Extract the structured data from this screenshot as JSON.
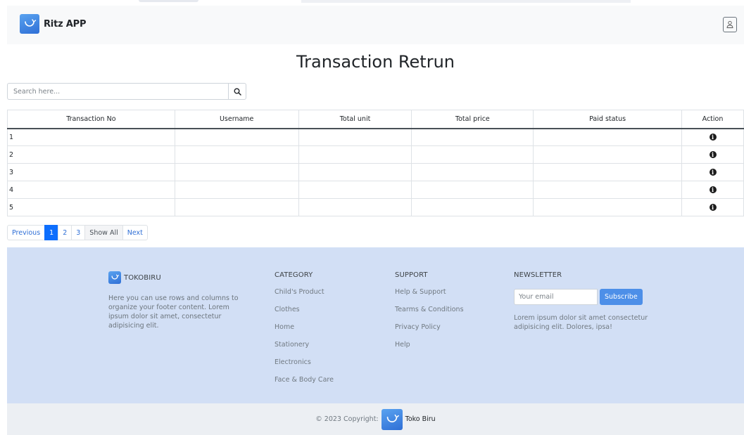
{
  "app": {
    "name": "Ritz APP"
  },
  "page": {
    "title": "Transaction Retrun"
  },
  "search": {
    "placeholder": "Search here..."
  },
  "table": {
    "headers": [
      "Transaction No",
      "Username",
      "Total unit",
      "Total price",
      "Paid status",
      "Action"
    ],
    "rows": [
      {
        "no": "1",
        "username": "",
        "unit": "",
        "price": "",
        "status": "",
        "action": "i"
      },
      {
        "no": "2",
        "username": "",
        "unit": "",
        "price": "",
        "status": "",
        "action": "i"
      },
      {
        "no": "3",
        "username": "",
        "unit": "",
        "price": "",
        "status": "",
        "action": "i"
      },
      {
        "no": "4",
        "username": "",
        "unit": "",
        "price": "",
        "status": "",
        "action": "i"
      },
      {
        "no": "5",
        "username": "",
        "unit": "",
        "price": "",
        "status": "",
        "action": "i"
      }
    ]
  },
  "pagination": {
    "previous": "Previous",
    "pages": [
      "1",
      "2",
      "3"
    ],
    "active_page": "1",
    "show_all": "Show All",
    "next": "Next"
  },
  "footer": {
    "brand": "TOKOBIRU",
    "about": "Here you can use rows and columns to organize your footer content. Lorem ipsum dolor sit amet, consectetur adipisicing elit.",
    "category": {
      "heading": "CATEGORY",
      "items": [
        "Child's Product",
        "Clothes",
        "Home",
        "Stationery",
        "Electronics",
        "Face & Body Care"
      ]
    },
    "support": {
      "heading": "SUPPORT",
      "items": [
        "Help & Support",
        "Tearms & Conditions",
        "Privacy Policy",
        "Help"
      ]
    },
    "newsletter": {
      "heading": "NEWSLETTER",
      "placeholder": "Your email",
      "button": "Subscribe",
      "text": "Lorem ipsum dolor sit amet consectetur adipisicing elit. Dolores, ipsa!"
    },
    "copyright": "© 2023 Copyright:",
    "site_name": "Toko Biru"
  },
  "icons": {
    "logo": "shopping-bag-icon",
    "user": "user-icon",
    "search": "search-icon",
    "action": "info-circle-icon"
  },
  "colors": {
    "accent": "#0d6efd",
    "footer_bg": "#d2dff5",
    "navbar_bg": "#f8f9fa",
    "subscribe_btn": "#4d8fe8"
  }
}
